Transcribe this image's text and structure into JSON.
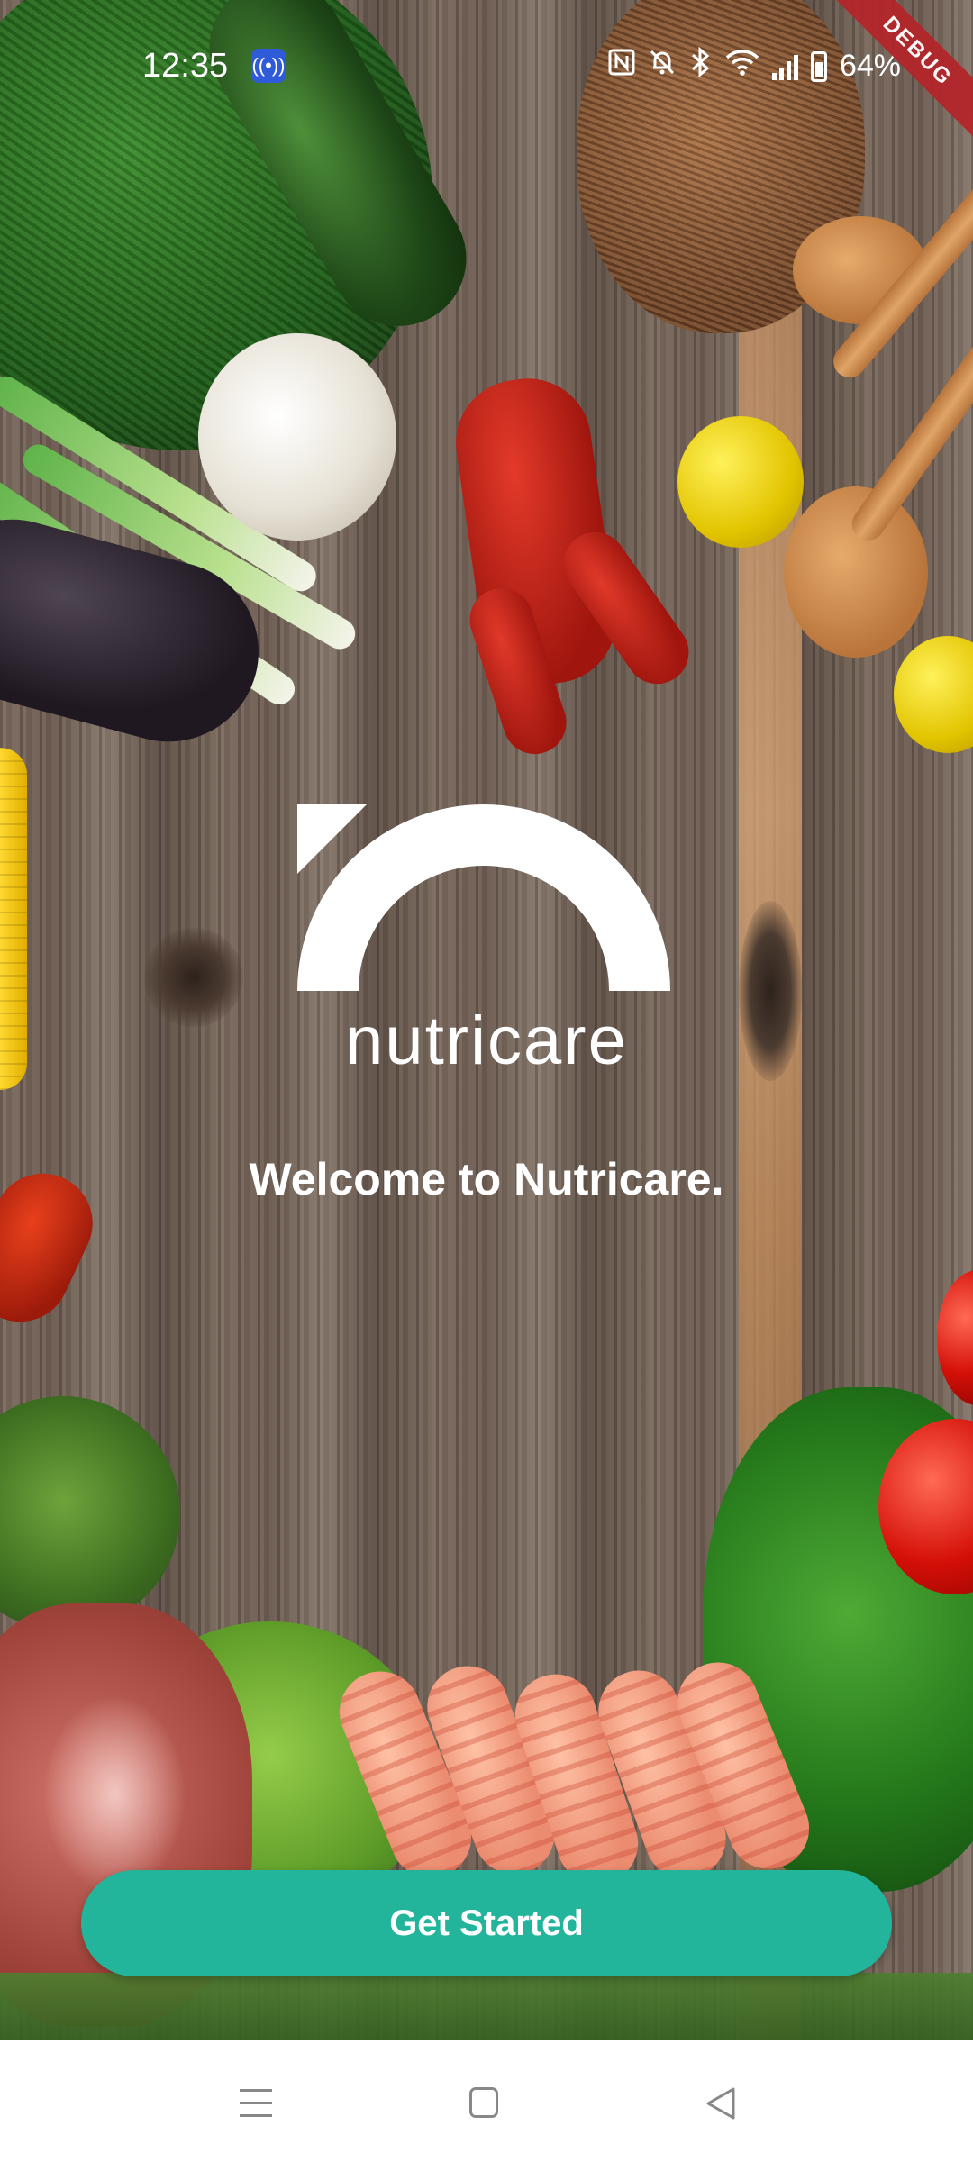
{
  "status_bar": {
    "time": "12:35",
    "battery_percent": "64%",
    "icons": [
      "cast-icon",
      "nfc-icon",
      "mute-icon",
      "bluetooth-icon",
      "wifi-icon",
      "signal-icon",
      "battery-icon"
    ]
  },
  "debug_banner": "DEBUG",
  "brand": {
    "name": "nutricare"
  },
  "welcome_text": "Welcome to Nutricare.",
  "cta_label": "Get Started",
  "nav_bar": {
    "icons": [
      "recents-icon",
      "home-icon",
      "back-icon"
    ]
  },
  "colors": {
    "accent": "#23B59B",
    "text": "#FFFFFF",
    "debug": "#B3262A"
  }
}
